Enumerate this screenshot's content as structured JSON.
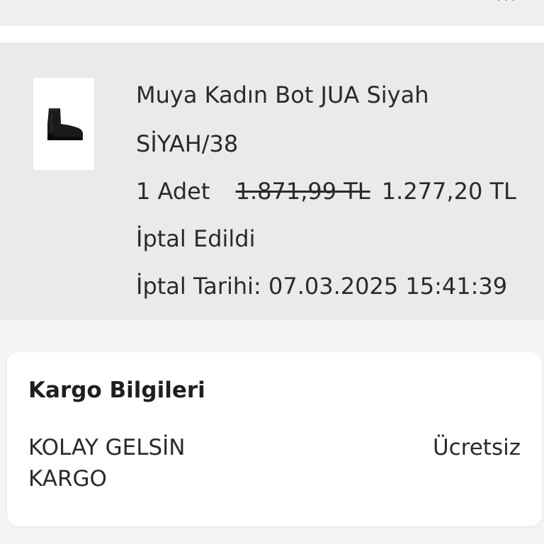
{
  "order_item": {
    "product_name": "Muya Kadın Bot JUA Siyah",
    "variant": "SİYAH/38",
    "quantity": "1 Adet",
    "old_price": "1.871,99 TL",
    "new_price": "1.277,20 TL",
    "status": "İptal Edildi",
    "cancel_date": "İptal Tarihi: 07.03.2025 15:41:39",
    "thumbnail_icon": "ankle-boot-icon"
  },
  "cargo": {
    "title": "Kargo Bilgileri",
    "carrier": "KOLAY GELSİN KARGO",
    "fee": "Ücretsiz"
  }
}
